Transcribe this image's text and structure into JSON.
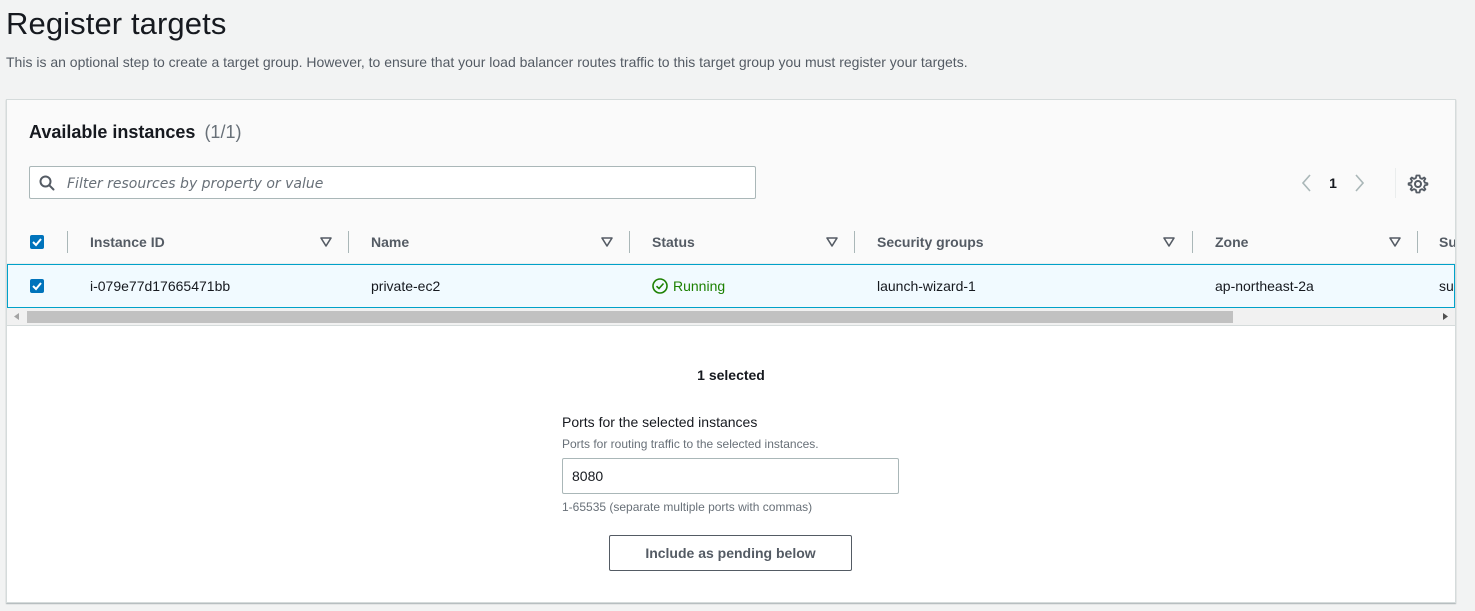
{
  "page": {
    "title": "Register targets",
    "description": "This is an optional step to create a target group. However, to ensure that your load balancer routes traffic to this target group you must register your targets."
  },
  "panel": {
    "title": "Available instances",
    "count": "(1/1)",
    "filter_placeholder": "Filter resources by property or value",
    "filter_value": "",
    "pager": {
      "current_page": "1"
    }
  },
  "table": {
    "header_checkbox_checked": true,
    "columns": [
      {
        "label": "Instance ID"
      },
      {
        "label": "Name"
      },
      {
        "label": "Status"
      },
      {
        "label": "Security groups"
      },
      {
        "label": "Zone"
      },
      {
        "label": "Su"
      }
    ],
    "rows": [
      {
        "selected": true,
        "instance_id": "i-079e77d17665471bb",
        "name": "private-ec2",
        "status": "Running",
        "security_groups": "launch-wizard-1",
        "zone": "ap-northeast-2a",
        "subnet_partial": "su"
      }
    ]
  },
  "selection": {
    "summary": "1 selected",
    "ports_label": "Ports for the selected instances",
    "ports_description": "Ports for routing traffic to the selected instances.",
    "ports_value": "8080",
    "ports_hint": "1-65535 (separate multiple ports with commas)",
    "include_button": "Include as pending below"
  },
  "colors": {
    "accent": "#0073bb",
    "status_running": "#1d8102",
    "row_selected_bg": "#f1faff",
    "row_selected_border": "#00a1c9"
  },
  "icons": {
    "search": "search-icon",
    "prev": "chevron-left-icon",
    "next": "chevron-right-icon",
    "settings": "gear-icon",
    "sort": "caret-down-icon",
    "status": "check-circle-icon"
  }
}
